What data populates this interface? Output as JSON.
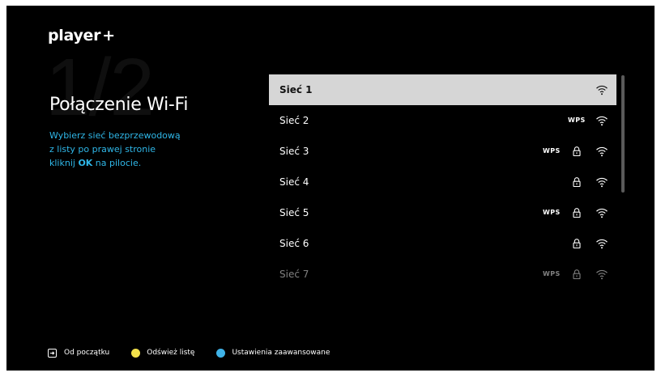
{
  "brand": {
    "name": "player",
    "plus": "+"
  },
  "step": "1/2",
  "title": "Połączenie Wi-Fi",
  "description": {
    "line1": "Wybierz sieć bezprzewodową",
    "line2": "z listy po prawej stronie",
    "line3_pre": "kliknij ",
    "line3_key": "OK",
    "line3_post": " na pilocie."
  },
  "networks": [
    {
      "name": "Sieć 1",
      "wps": false,
      "locked": false,
      "selected": true
    },
    {
      "name": "Sieć 2",
      "wps": true,
      "locked": false
    },
    {
      "name": "Sieć 3",
      "wps": true,
      "locked": true
    },
    {
      "name": "Sieć 4",
      "wps": false,
      "locked": true
    },
    {
      "name": "Sieć 5",
      "wps": true,
      "locked": true
    },
    {
      "name": "Sieć 6",
      "wps": false,
      "locked": true
    },
    {
      "name": "Sieć 7",
      "wps": true,
      "locked": true,
      "dim": true
    }
  ],
  "wps_label": "WPS",
  "footer": {
    "back_label": "Od początku",
    "refresh_label": "Odśwież listę",
    "advanced_label": "Ustawienia zaawansowane"
  },
  "colors": {
    "accent": "#2fb7e8",
    "yellow_key": "#f3e14b",
    "blue_key": "#3fb3e8",
    "selected_row": "#d6d6d6"
  },
  "icons": {
    "wifi": "wifi-icon",
    "lock": "lock-icon",
    "back": "back-arrow-icon"
  }
}
